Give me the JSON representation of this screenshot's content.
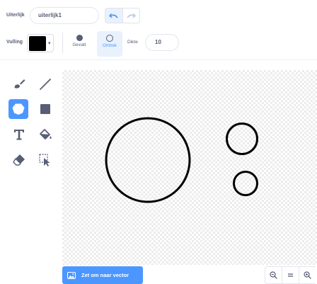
{
  "costume": {
    "name_label": "Uiterlijk",
    "name_value": "uiterlijk1"
  },
  "history": {
    "undo_icon": "undo-icon",
    "redo_icon": "redo-icon"
  },
  "fill": {
    "label": "Vulling",
    "color": "#000000"
  },
  "modes": {
    "filled_label": "Gevuld",
    "outline_label": "Omtrek",
    "selected": "outline"
  },
  "thickness": {
    "label": "Dikte",
    "value": "10"
  },
  "tools": [
    {
      "name": "brush",
      "icon": "brush-icon",
      "selected": false
    },
    {
      "name": "line",
      "icon": "line-icon",
      "selected": false
    },
    {
      "name": "circle",
      "icon": "circle-icon",
      "selected": true
    },
    {
      "name": "rectangle",
      "icon": "rectangle-icon",
      "selected": false
    },
    {
      "name": "text",
      "icon": "text-icon",
      "selected": false
    },
    {
      "name": "fill",
      "icon": "fill-bucket-icon",
      "selected": false
    },
    {
      "name": "eraser",
      "icon": "eraser-icon",
      "selected": false
    },
    {
      "name": "select",
      "icon": "select-icon",
      "selected": false
    }
  ],
  "footer": {
    "convert_label": "Zet om naar vector",
    "zoom_out_icon": "zoom-out-icon",
    "zoom_reset_icon": "zoom-reset-icon",
    "zoom_in_icon": "zoom-in-icon"
  },
  "colors": {
    "accent": "#4c97ff",
    "text": "#575e75",
    "selected_bg": "#e9f1fc"
  }
}
